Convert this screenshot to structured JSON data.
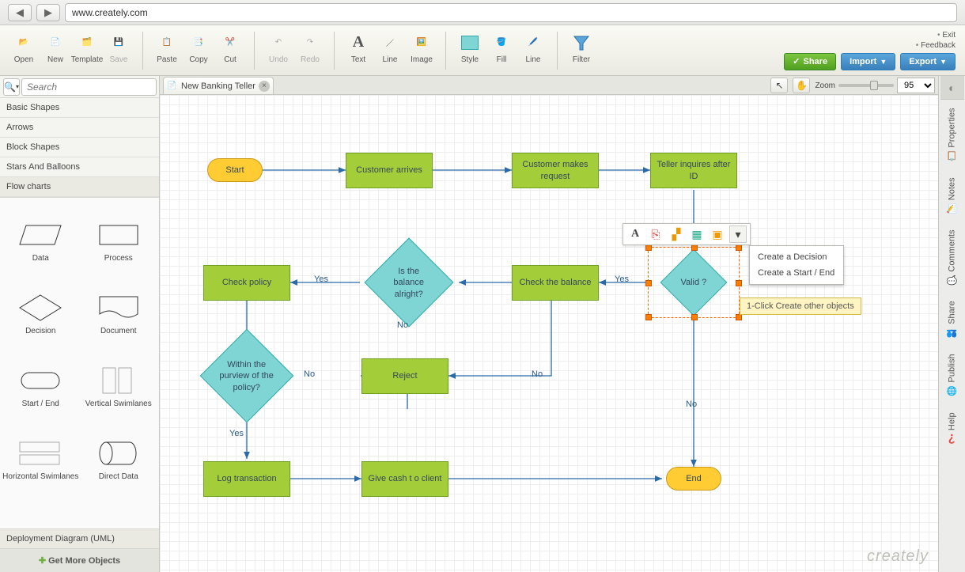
{
  "browser": {
    "url": "www.creately.com"
  },
  "toolbar": {
    "open": "Open",
    "new": "New",
    "template": "Template",
    "save": "Save",
    "paste": "Paste",
    "copy": "Copy",
    "cut": "Cut",
    "undo": "Undo",
    "redo": "Redo",
    "text": "Text",
    "line": "Line",
    "image": "Image",
    "style": "Style",
    "fill": "Fill",
    "line2": "Line",
    "filter": "Filter"
  },
  "actions": {
    "share": "Share",
    "import": "Import",
    "export": "Export"
  },
  "meta": {
    "exit": "Exit",
    "feedback": "Feedback"
  },
  "search": {
    "placeholder": "Search"
  },
  "categories": [
    "Basic Shapes",
    "Arrows",
    "Block Shapes",
    "Stars And Balloons",
    "Flow charts"
  ],
  "shapes": [
    "Data",
    "Process",
    "Decision",
    "Document",
    "Start / End",
    "Vertical Swimlanes",
    "Horizontal Swimlanes",
    "Direct Data"
  ],
  "sidebar_footer": "Deployment Diagram (UML)",
  "sidebar_getmore": "Get More Objects",
  "tab": {
    "title": "New Banking Teller"
  },
  "zoom": {
    "label": "Zoom",
    "value": "95"
  },
  "flow": {
    "start": "Start",
    "arrives": "Customer arrives",
    "request": "Customer makes request",
    "teller": "Teller inquires after ID",
    "valid": "Valid ?",
    "check_balance": "Check the balance",
    "balance_ok": "Is the balance  alright?",
    "check_policy": "Check policy",
    "within_policy": "Within the purview  of the policy?",
    "reject": "Reject",
    "log": "Log transaction",
    "give": "Give cash t o client",
    "end": "End",
    "yes": "Yes",
    "no": "No"
  },
  "context_menu": {
    "d1": "Create a Decision",
    "d2": "Create a Start / End"
  },
  "tooltip": "1-Click Create other objects",
  "rail": [
    "Properties",
    "Notes",
    "Comments",
    "Share",
    "Publish",
    "Help"
  ],
  "logo": "creately"
}
